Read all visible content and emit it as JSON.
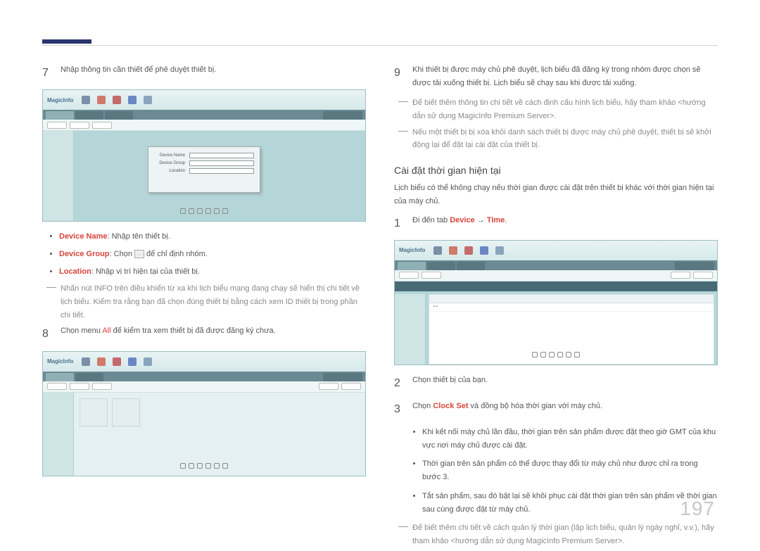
{
  "page_number": "197",
  "left": {
    "step7": {
      "num": "7",
      "text": "Nhập thông tin cần thiết để phê duyệt thiết bị."
    },
    "bullets": {
      "b1_label": "Device Name",
      "b1_text": ": Nhập tên thiết bị.",
      "b2_label": "Device Group",
      "b2_text": ": Chọn ",
      "b2_tail": " để chỉ định nhóm.",
      "b3_label": "Location",
      "b3_text": ": Nhập vị trí hiện tại của thiết bị."
    },
    "note1": "Nhấn nút INFO trên điều khiển từ xa khi lịch biểu mạng đang chạy sẽ hiển thị chi tiết về lịch biểu. Kiểm tra rằng bạn đã chọn đúng thiết bị bằng cách xem ID thiết bị trong phần chi tiết.",
    "step8": {
      "num": "8",
      "text_a": "Chọn menu ",
      "all": "All",
      "text_b": " để kiểm tra xem thiết bị đã được đăng ký chưa."
    }
  },
  "right": {
    "step9": {
      "num": "9",
      "text": "Khi thiết bị được máy chủ phê duyệt, lịch biểu đã đăng ký trong nhóm được chọn sẽ được tải xuống thiết bị. Lịch biểu sẽ chạy sau khi được tải xuống."
    },
    "note_a": "Để biết thêm thông tin chi tiết về cách định cấu hình lịch biểu, hãy tham khảo <hướng dẫn sử dụng MagicInfo Premium Server>.",
    "note_b": "Nếu một thiết bị bị xóa khỏi danh sách thiết bị được máy chủ phê duyệt, thiết bị sẽ khởi động lại để đặt lại cài đặt của thiết bị.",
    "section_title": "Cài đặt thời gian hiện tại",
    "section_intro": "Lịch biểu có thể không chạy nếu thời gian được cài đặt trên thiết bị khác với thời gian hiện tại của máy chủ.",
    "step1": {
      "num": "1",
      "text_a": "Đi đến tab ",
      "red1": "Device",
      "arrow": " → ",
      "red2": "Time",
      "dot": "."
    },
    "step2": {
      "num": "2",
      "text": "Chọn thiết bị của bạn."
    },
    "step3": {
      "num": "3",
      "text_a": "Chọn ",
      "red": "Clock Set",
      "text_b": " và đồng bộ hóa thời gian với máy chủ."
    },
    "sub": {
      "s1": "Khi kết nối máy chủ lần đầu, thời gian trên sản phẩm được đặt theo giờ GMT của khu vực nơi máy chủ được cài đặt.",
      "s2": "Thời gian trên sản phẩm có thể được thay đổi từ máy chủ như được chỉ ra trong bước 3.",
      "s3": "Tắt sản phẩm, sau đó bật lại sẽ khôi phục cài đặt thời gian trên sản phẩm về thời gian sau cùng được đặt từ máy chủ."
    },
    "note_c": "Để biết thêm chi tiết về cách quản lý thời gian (lập lịch biểu, quản lý ngày nghỉ, v.v.), hãy tham khảo <hướng dẫn sử dụng MagicInfo Premium Server>."
  },
  "screenshot_labels": {
    "logo": "MagicInfo",
    "dlg_device_name": "Device Name",
    "dlg_device_group": "Device Group",
    "dlg_location": "Location"
  }
}
